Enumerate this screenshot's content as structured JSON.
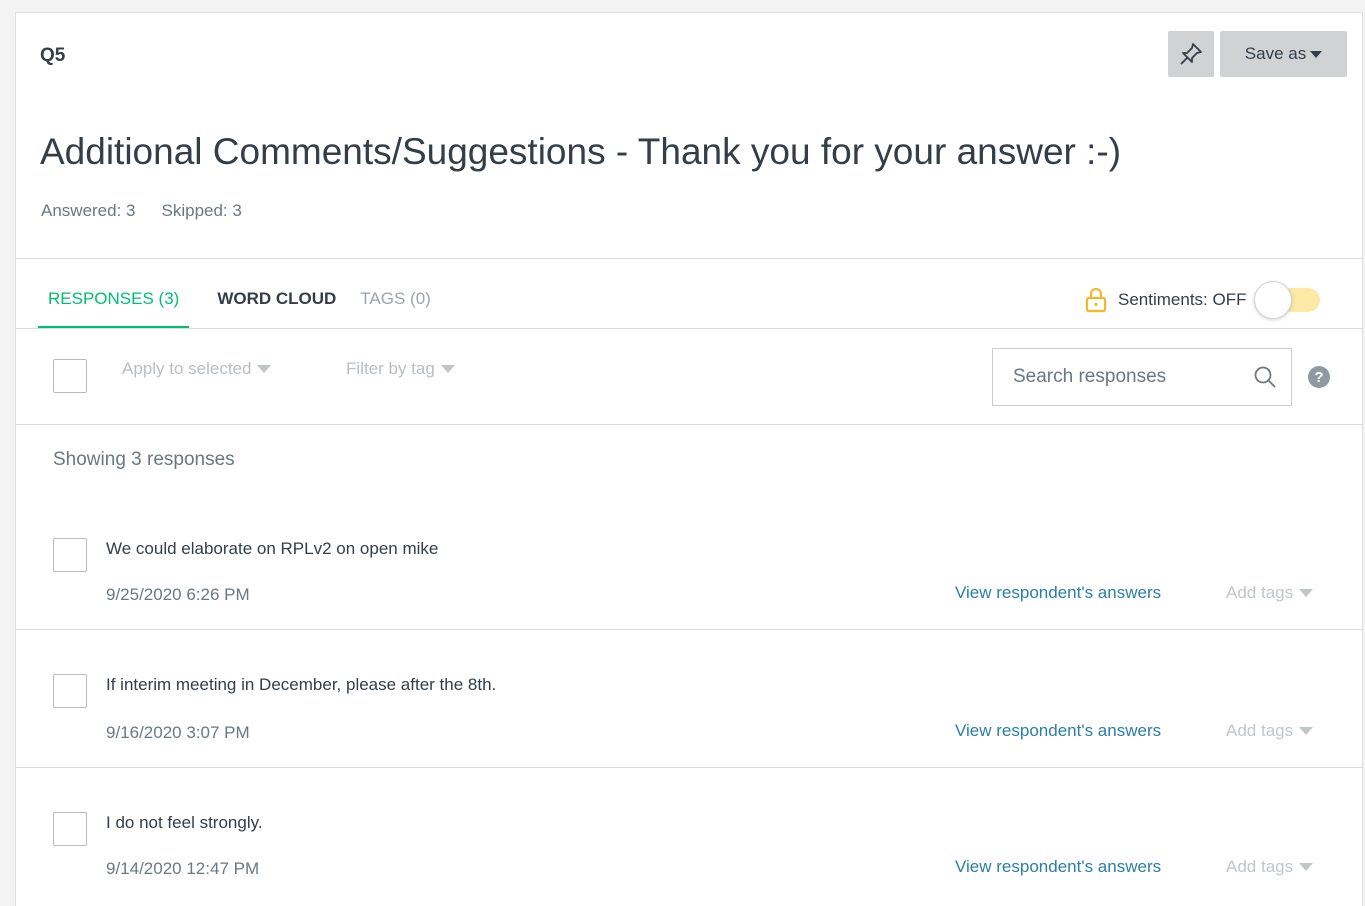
{
  "header": {
    "question_number": "Q5",
    "save_label": "Save as",
    "title": "Additional Comments/Suggestions - Thank you for your answer :-)",
    "answered": "Answered: 3",
    "skipped": "Skipped: 3"
  },
  "tabs": [
    {
      "label": "RESPONSES (3)",
      "state": "active"
    },
    {
      "label": "WORD CLOUD",
      "state": "normal"
    },
    {
      "label": "TAGS (0)",
      "state": "disabled"
    }
  ],
  "sentiments": {
    "label": "Sentiments: OFF",
    "enabled": false
  },
  "toolbar": {
    "apply_label": "Apply to selected",
    "filter_label": "Filter by tag",
    "search_placeholder": "Search responses",
    "help_glyph": "?"
  },
  "showing": "Showing 3 responses",
  "responses": [
    {
      "text": "We could elaborate on RPLv2 on open mike",
      "date": "9/25/2020 6:26 PM",
      "link": "View respondent's answers",
      "tags": "Add tags"
    },
    {
      "text": "If interim meeting in December, please after the 8th.",
      "date": "9/16/2020 3:07 PM",
      "link": "View respondent's answers",
      "tags": "Add tags"
    },
    {
      "text": "I do not feel strongly.",
      "date": "9/14/2020 12:47 PM",
      "link": "View respondent's answers",
      "tags": "Add tags"
    }
  ],
  "colors": {
    "accent": "#00bf6f",
    "link": "#2a7fa6",
    "toggle_track": "#fde9a6",
    "lock": "#f2b830"
  }
}
